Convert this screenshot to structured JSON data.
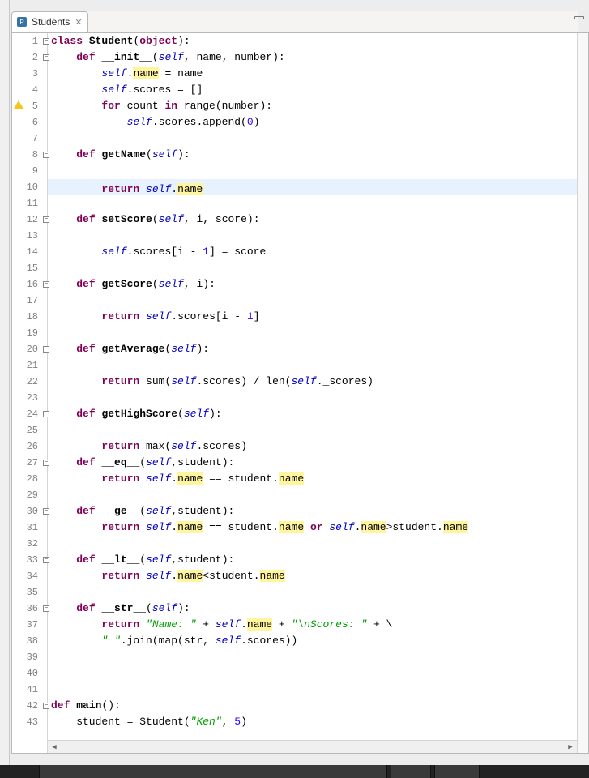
{
  "tab": {
    "title": "Students",
    "icon": "python-file-icon"
  },
  "highlight_word": "name",
  "current_line_index": 9,
  "lines": [
    {
      "n": 1,
      "fold": true,
      "tokens": [
        [
          "kw",
          "class"
        ],
        [
          "",
          " "
        ],
        [
          "cls",
          "Student"
        ],
        [
          "",
          "("
        ],
        [
          "kw",
          "object"
        ],
        [
          "",
          "):"
        ]
      ]
    },
    {
      "n": 2,
      "fold": true,
      "tokens": [
        [
          "",
          "    "
        ],
        [
          "kw",
          "def"
        ],
        [
          "",
          " "
        ],
        [
          "fn",
          "__init__"
        ],
        [
          "",
          "("
        ],
        [
          "self",
          "self"
        ],
        [
          "",
          ", name, number):"
        ]
      ]
    },
    {
      "n": 3,
      "tokens": [
        [
          "",
          "        "
        ],
        [
          "self",
          "self"
        ],
        [
          "",
          "."
        ],
        [
          "hl",
          "name"
        ],
        [
          "",
          " = name"
        ]
      ]
    },
    {
      "n": 4,
      "tokens": [
        [
          "",
          "        "
        ],
        [
          "self",
          "self"
        ],
        [
          "",
          ".scores = []"
        ]
      ]
    },
    {
      "n": 5,
      "warn": true,
      "tokens": [
        [
          "",
          "        "
        ],
        [
          "kw",
          "for"
        ],
        [
          "",
          " count "
        ],
        [
          "kw",
          "in"
        ],
        [
          "",
          " range(number):"
        ]
      ]
    },
    {
      "n": 6,
      "tokens": [
        [
          "",
          "            "
        ],
        [
          "self",
          "self"
        ],
        [
          "",
          ".scores.append("
        ],
        [
          "num-lit",
          "0"
        ],
        [
          "",
          ")"
        ]
      ]
    },
    {
      "n": 7,
      "tokens": []
    },
    {
      "n": 8,
      "fold": true,
      "tokens": [
        [
          "",
          "    "
        ],
        [
          "kw",
          "def"
        ],
        [
          "",
          " "
        ],
        [
          "fn",
          "getName"
        ],
        [
          "",
          "("
        ],
        [
          "self",
          "self"
        ],
        [
          "",
          "):"
        ]
      ]
    },
    {
      "n": 9,
      "tokens": []
    },
    {
      "n": 10,
      "tokens": [
        [
          "",
          "        "
        ],
        [
          "kw",
          "return"
        ],
        [
          "",
          " "
        ],
        [
          "self",
          "self"
        ],
        [
          "",
          "."
        ],
        [
          "hl",
          "name"
        ]
      ],
      "cursor_after": true
    },
    {
      "n": 11,
      "tokens": []
    },
    {
      "n": 12,
      "fold": true,
      "tokens": [
        [
          "",
          "    "
        ],
        [
          "kw",
          "def"
        ],
        [
          "",
          " "
        ],
        [
          "fn",
          "setScore"
        ],
        [
          "",
          "("
        ],
        [
          "self",
          "self"
        ],
        [
          "",
          ", i, score):"
        ]
      ]
    },
    {
      "n": 13,
      "tokens": []
    },
    {
      "n": 14,
      "tokens": [
        [
          "",
          "        "
        ],
        [
          "self",
          "self"
        ],
        [
          "",
          ".scores[i - "
        ],
        [
          "num-lit",
          "1"
        ],
        [
          "",
          "] = score"
        ]
      ]
    },
    {
      "n": 15,
      "tokens": []
    },
    {
      "n": 16,
      "fold": true,
      "tokens": [
        [
          "",
          "    "
        ],
        [
          "kw",
          "def"
        ],
        [
          "",
          " "
        ],
        [
          "fn",
          "getScore"
        ],
        [
          "",
          "("
        ],
        [
          "self",
          "self"
        ],
        [
          "",
          ", i):"
        ]
      ]
    },
    {
      "n": 17,
      "tokens": []
    },
    {
      "n": 18,
      "tokens": [
        [
          "",
          "        "
        ],
        [
          "kw",
          "return"
        ],
        [
          "",
          " "
        ],
        [
          "self",
          "self"
        ],
        [
          "",
          ".scores[i - "
        ],
        [
          "num-lit",
          "1"
        ],
        [
          "",
          "]"
        ]
      ]
    },
    {
      "n": 19,
      "tokens": []
    },
    {
      "n": 20,
      "fold": true,
      "tokens": [
        [
          "",
          "    "
        ],
        [
          "kw",
          "def"
        ],
        [
          "",
          " "
        ],
        [
          "fn",
          "getAverage"
        ],
        [
          "",
          "("
        ],
        [
          "self",
          "self"
        ],
        [
          "",
          "):"
        ]
      ]
    },
    {
      "n": 21,
      "tokens": []
    },
    {
      "n": 22,
      "tokens": [
        [
          "",
          "        "
        ],
        [
          "kw",
          "return"
        ],
        [
          "",
          " sum("
        ],
        [
          "self",
          "self"
        ],
        [
          "",
          ".scores) / len("
        ],
        [
          "self",
          "self"
        ],
        [
          "",
          "._scores)"
        ]
      ]
    },
    {
      "n": 23,
      "tokens": []
    },
    {
      "n": 24,
      "fold": true,
      "tokens": [
        [
          "",
          "    "
        ],
        [
          "kw",
          "def"
        ],
        [
          "",
          " "
        ],
        [
          "fn",
          "getHighScore"
        ],
        [
          "",
          "("
        ],
        [
          "self",
          "self"
        ],
        [
          "",
          "):"
        ]
      ]
    },
    {
      "n": 25,
      "tokens": []
    },
    {
      "n": 26,
      "tokens": [
        [
          "",
          "        "
        ],
        [
          "kw",
          "return"
        ],
        [
          "",
          " max("
        ],
        [
          "self",
          "self"
        ],
        [
          "",
          ".scores)"
        ]
      ]
    },
    {
      "n": 27,
      "fold": true,
      "tokens": [
        [
          "",
          "    "
        ],
        [
          "kw",
          "def"
        ],
        [
          "",
          " "
        ],
        [
          "fn",
          "__eq__"
        ],
        [
          "",
          "("
        ],
        [
          "self",
          "self"
        ],
        [
          "",
          ",student):"
        ]
      ]
    },
    {
      "n": 28,
      "tokens": [
        [
          "",
          "        "
        ],
        [
          "kw",
          "return"
        ],
        [
          "",
          " "
        ],
        [
          "self",
          "self"
        ],
        [
          "",
          "."
        ],
        [
          "hl",
          "name"
        ],
        [
          "",
          " == student."
        ],
        [
          "hl",
          "name"
        ]
      ]
    },
    {
      "n": 29,
      "tokens": []
    },
    {
      "n": 30,
      "fold": true,
      "tokens": [
        [
          "",
          "    "
        ],
        [
          "kw",
          "def"
        ],
        [
          "",
          " "
        ],
        [
          "fn",
          "__ge__"
        ],
        [
          "",
          "("
        ],
        [
          "self",
          "self"
        ],
        [
          "",
          ",student):"
        ]
      ]
    },
    {
      "n": 31,
      "tokens": [
        [
          "",
          "        "
        ],
        [
          "kw",
          "return"
        ],
        [
          "",
          " "
        ],
        [
          "self",
          "self"
        ],
        [
          "",
          "."
        ],
        [
          "hl",
          "name"
        ],
        [
          "",
          " == student."
        ],
        [
          "hl",
          "name"
        ],
        [
          "",
          " "
        ],
        [
          "kw",
          "or"
        ],
        [
          "",
          " "
        ],
        [
          "self",
          "self"
        ],
        [
          "",
          "."
        ],
        [
          "hl",
          "name"
        ],
        [
          "",
          ">student."
        ],
        [
          "hl",
          "name"
        ]
      ]
    },
    {
      "n": 32,
      "tokens": []
    },
    {
      "n": 33,
      "fold": true,
      "tokens": [
        [
          "",
          "    "
        ],
        [
          "kw",
          "def"
        ],
        [
          "",
          " "
        ],
        [
          "fn",
          "__lt__"
        ],
        [
          "",
          "("
        ],
        [
          "self",
          "self"
        ],
        [
          "",
          ",student):"
        ]
      ]
    },
    {
      "n": 34,
      "tokens": [
        [
          "",
          "        "
        ],
        [
          "kw",
          "return"
        ],
        [
          "",
          " "
        ],
        [
          "self",
          "self"
        ],
        [
          "",
          "."
        ],
        [
          "hl",
          "name"
        ],
        [
          "",
          "<student."
        ],
        [
          "hl",
          "name"
        ]
      ]
    },
    {
      "n": 35,
      "tokens": []
    },
    {
      "n": 36,
      "fold": true,
      "tokens": [
        [
          "",
          "    "
        ],
        [
          "kw",
          "def"
        ],
        [
          "",
          " "
        ],
        [
          "fn",
          "__str__"
        ],
        [
          "",
          "("
        ],
        [
          "self",
          "self"
        ],
        [
          "",
          "):"
        ]
      ]
    },
    {
      "n": 37,
      "tokens": [
        [
          "",
          "        "
        ],
        [
          "kw",
          "return"
        ],
        [
          "",
          " "
        ],
        [
          "str",
          "\"Name: \""
        ],
        [
          "",
          " + "
        ],
        [
          "self",
          "self"
        ],
        [
          "",
          "."
        ],
        [
          "hl",
          "name"
        ],
        [
          "",
          " + "
        ],
        [
          "str",
          "\"\\nScores: \""
        ],
        [
          "",
          " + \\"
        ]
      ]
    },
    {
      "n": 38,
      "tokens": [
        [
          "",
          "        "
        ],
        [
          "str",
          "\" \""
        ],
        [
          "",
          ".join(map(str, "
        ],
        [
          "self",
          "self"
        ],
        [
          "",
          ".scores))"
        ]
      ]
    },
    {
      "n": 39,
      "tokens": []
    },
    {
      "n": 40,
      "tokens": []
    },
    {
      "n": 41,
      "tokens": []
    },
    {
      "n": 42,
      "fold": true,
      "tokens": [
        [
          "kw",
          "def"
        ],
        [
          "",
          " "
        ],
        [
          "fn",
          "main"
        ],
        [
          "",
          "():"
        ]
      ]
    },
    {
      "n": 43,
      "tokens": [
        [
          "",
          "    student = Student("
        ],
        [
          "str",
          "\"Ken\""
        ],
        [
          "",
          ", "
        ],
        [
          "num-lit",
          "5"
        ],
        [
          "",
          ")"
        ]
      ]
    }
  ]
}
